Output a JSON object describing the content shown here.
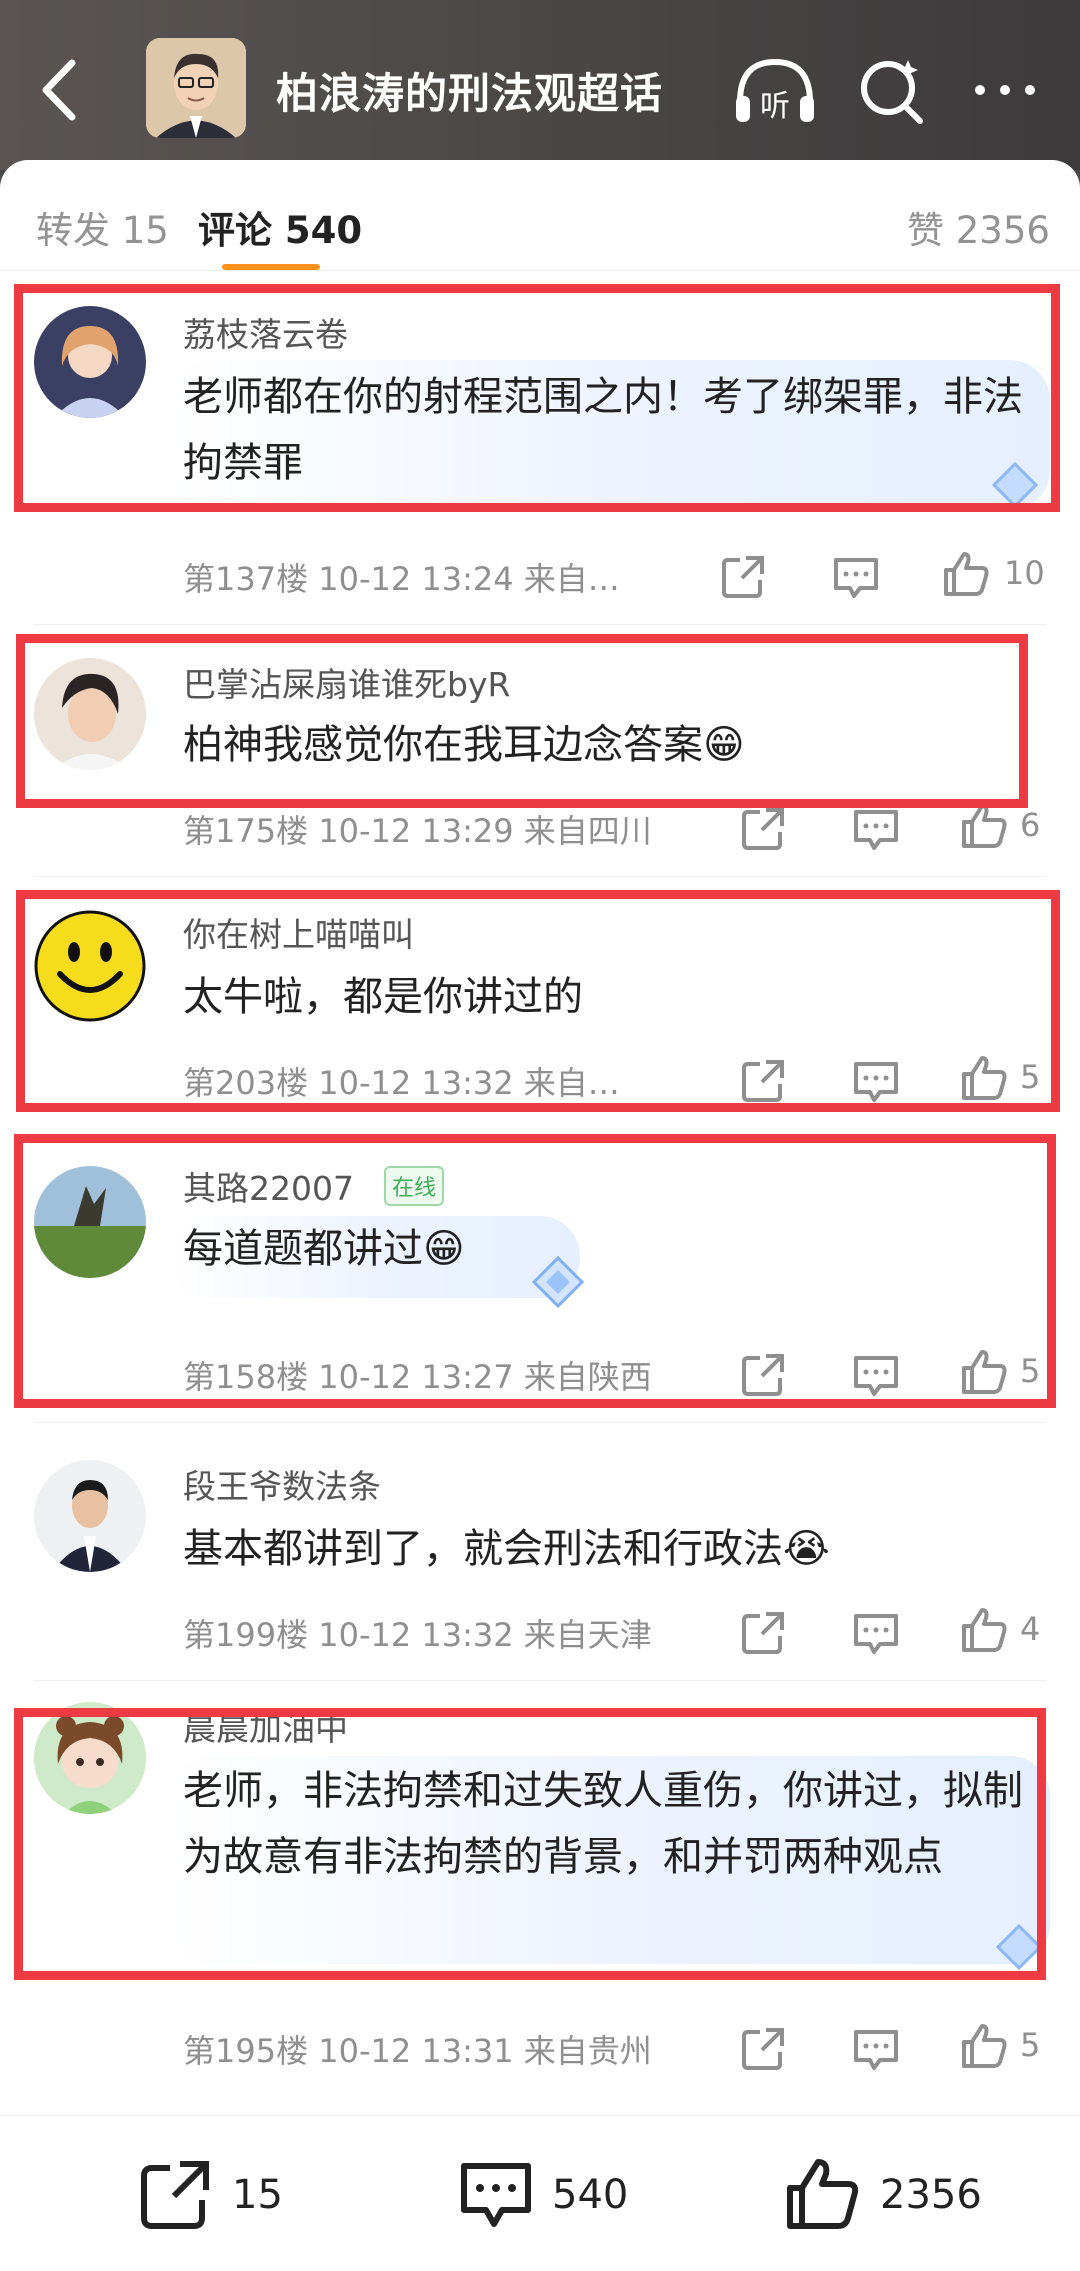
{
  "header": {
    "title": "柏浪涛的刑法观超话",
    "listen_label": "听"
  },
  "tabs": {
    "repost": "转发 15",
    "comments": "评论 540",
    "likes": "赞 2356"
  },
  "comments": [
    {
      "user": "荔枝落云卷",
      "text": "老师都在你的射程范围之内！考了绑架罪，非法拘禁罪",
      "meta": "第137楼  10-12 13:24  来自…",
      "likes": "10"
    },
    {
      "user": "巴掌沾屎扇谁谁死byR",
      "text": "柏神我感觉你在我耳边念答案😁",
      "meta": "第175楼  10-12 13:29  来自四川",
      "likes": "6"
    },
    {
      "user": "你在树上喵喵叫",
      "text": "太牛啦，都是你讲过的",
      "meta": "第203楼  10-12 13:32  来自…",
      "likes": "5"
    },
    {
      "user": "其路22007",
      "badge": "在线",
      "text": "每道题都讲过😁",
      "meta": "第158楼  10-12 13:27  来自陕西",
      "likes": "5"
    },
    {
      "user": "段王爷数法条",
      "text": "基本都讲到了，就会刑法和行政法😭",
      "meta": "第199楼  10-12 13:32  来自天津",
      "likes": "4"
    },
    {
      "user": "晨晨加油中",
      "text": "老师，非法拘禁和过失致人重伤，你讲过，拟制为故意有非法拘禁的背景，和并罚两种观点",
      "meta": "第195楼  10-12 13:31  来自贵州",
      "likes": "5"
    }
  ],
  "bottom": {
    "reposts": "15",
    "comments": "540",
    "likes": "2356"
  },
  "colors": {
    "highlight_box": "#ee3a43",
    "tab_underline": "#f9931e"
  }
}
